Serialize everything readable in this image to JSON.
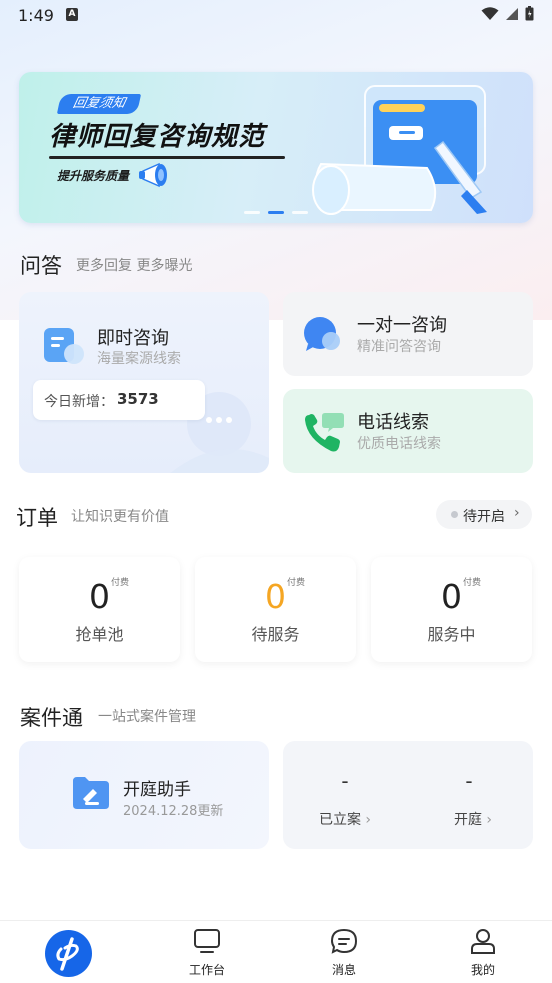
{
  "status_bar": {
    "time": "1:49",
    "notif_icon": "A"
  },
  "banner": {
    "tag": "回复须知",
    "title": "律师回复咨询规范",
    "subtitle": "提升服务质量",
    "pages": 3,
    "active_page": 2
  },
  "qa": {
    "title": "问答",
    "subtitle": "更多回复 更多曝光",
    "instant": {
      "title": "即时咨询",
      "subtitle": "海量案源线索",
      "new_label": "今日新增：",
      "new_value": "3573"
    },
    "one_on_one": {
      "title": "一对一咨询",
      "subtitle": "精准问答咨询"
    },
    "phone": {
      "title": "电话线索",
      "subtitle": "优质电话线索"
    }
  },
  "orders": {
    "title": "订单",
    "subtitle": "让知识更有价值",
    "status_button": "待开启",
    "cards": [
      {
        "value": "0",
        "tag": "付费",
        "label": "抢单池"
      },
      {
        "value": "0",
        "tag": "付费",
        "label": "待服务"
      },
      {
        "value": "0",
        "tag": "付费",
        "label": "服务中"
      }
    ]
  },
  "cases": {
    "title": "案件通",
    "subtitle": "一站式案件管理",
    "court": {
      "title": "开庭助手",
      "date": "2024.12.28更新"
    },
    "stats": [
      {
        "value": "-",
        "label": "已立案"
      },
      {
        "value": "-",
        "label": "开庭"
      }
    ]
  },
  "nav": {
    "items": [
      {
        "label": "",
        "icon": "home-logo-icon"
      },
      {
        "label": "工作台",
        "icon": "monitor-icon"
      },
      {
        "label": "消息",
        "icon": "message-icon"
      },
      {
        "label": "我的",
        "icon": "user-icon"
      }
    ]
  },
  "colors": {
    "brand": "#1666e8",
    "accent_orange": "#f5a623",
    "phone_bg": "#e6f6ee"
  }
}
